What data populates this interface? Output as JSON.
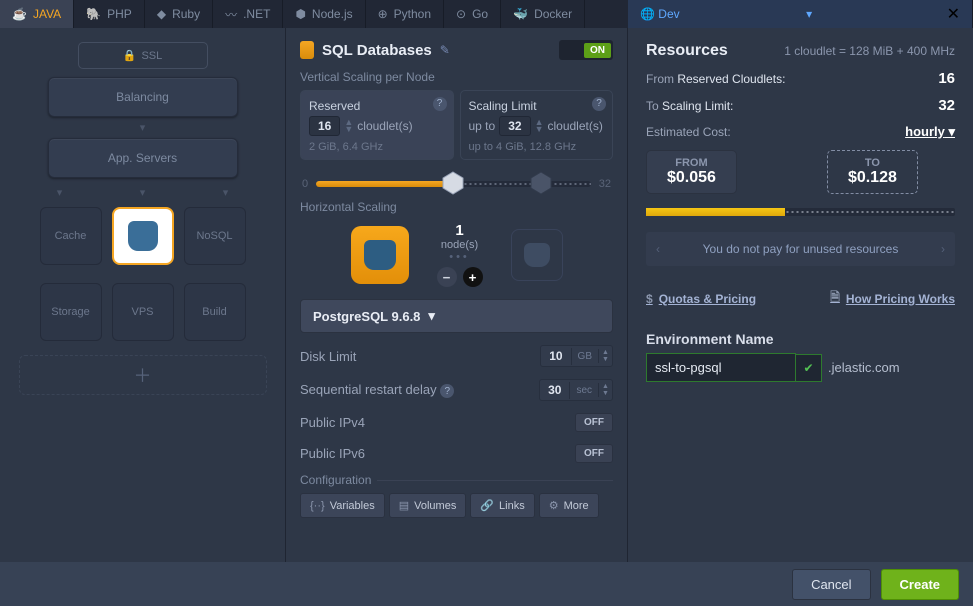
{
  "tabs": {
    "java": "JAVA",
    "php": "PHP",
    "ruby": "Ruby",
    "dotnet": ".NET",
    "node": "Node.js",
    "python": "Python",
    "go": "Go",
    "docker": "Docker",
    "dev": "Dev"
  },
  "topo": {
    "ssl": "SSL",
    "balancing": "Balancing",
    "appservers": "App. Servers",
    "cache": "Cache",
    "nosql": "NoSQL",
    "storage": "Storage",
    "vps": "VPS",
    "build": "Build"
  },
  "mid": {
    "title": "SQL Databases",
    "toggle": "ON",
    "vscale": "Vertical Scaling per Node",
    "reserved": {
      "label": "Reserved",
      "value": "16",
      "unit": "cloudlet(s)",
      "spec": "2 GiB, 6.4 GHz"
    },
    "limit": {
      "label": "Scaling Limit",
      "prefix": "up to",
      "value": "32",
      "unit": "cloudlet(s)",
      "spec": "up to 4 GiB, 12.8 GHz"
    },
    "slider": {
      "min": "0",
      "max": "32"
    },
    "hscale": "Horizontal Scaling",
    "nodes": {
      "count": "1",
      "label": "node(s)"
    },
    "version": "PostgreSQL 9.6.8",
    "disk": {
      "label": "Disk Limit",
      "value": "10",
      "unit": "GB"
    },
    "delay": {
      "label": "Sequential restart delay",
      "value": "30",
      "unit": "sec"
    },
    "ipv4": "Public IPv4",
    "ipv6": "Public IPv6",
    "off": "OFF",
    "config": "Configuration",
    "btns": {
      "vars": "Variables",
      "vols": "Volumes",
      "links": "Links",
      "more": "More"
    }
  },
  "right": {
    "title": "Resources",
    "formula": "1 cloudlet = 128 MiB + 400 MHz",
    "from_label": "From",
    "reserved_label": "Reserved Cloudlets:",
    "from_val": "16",
    "to_label": "To",
    "limit_label": "Scaling Limit:",
    "to_val": "32",
    "est": "Estimated Cost:",
    "period": "hourly",
    "from_head": "FROM",
    "from_price": "$0.056",
    "to_head": "TO",
    "to_price": "$0.128",
    "note": "You do not pay for unused resources",
    "quotas": "Quotas & Pricing",
    "how": "How Pricing Works",
    "env_label": "Environment Name",
    "env_value": "ssl-to-pgsql",
    "env_suffix": ".jelastic.com"
  },
  "footer": {
    "cancel": "Cancel",
    "create": "Create"
  }
}
